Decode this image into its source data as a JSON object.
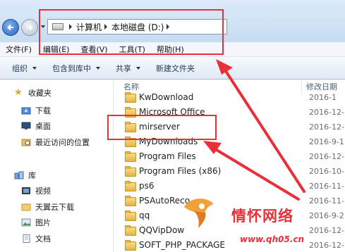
{
  "address": {
    "crumbs": [
      "计算机",
      "本地磁盘 (D:)"
    ]
  },
  "menu": [
    "文件(F)",
    "编辑(E)",
    "查看(V)",
    "工具(T)",
    "帮助(H)"
  ],
  "toolbar": {
    "organize": "组织",
    "include_library": "包含到库中",
    "share": "共享",
    "new_folder": "新建文件夹"
  },
  "sidebar": {
    "favorites": "收藏夹",
    "favorites_items": [
      "下载",
      "桌面",
      "最近访问的位置"
    ],
    "libraries": "库",
    "library_items": [
      "视频",
      "天翼云下载",
      "图片",
      "文档"
    ]
  },
  "columns": {
    "name": "名称",
    "date": "修改日期"
  },
  "files": [
    {
      "name": "KwDownload",
      "date": "2016-1"
    },
    {
      "name": "Microsoft Office",
      "date": "2016-12-"
    },
    {
      "name": "mirserver",
      "date": "2016-12-"
    },
    {
      "name": "MyDownloads",
      "date": "2016-9-1"
    },
    {
      "name": "Program Files",
      "date": "2016-12-"
    },
    {
      "name": "Program Files (x86)",
      "date": "2016-10-"
    },
    {
      "name": "ps6",
      "date": "2016-11-"
    },
    {
      "name": "PSAutoReco",
      "date": "2016-11-"
    },
    {
      "name": "qq",
      "date": "2016-9-2"
    },
    {
      "name": "QQVipDow",
      "date": "2016-12-"
    },
    {
      "name": "SOFT_PHP_PACKAGE",
      "date": "2016-12-"
    }
  ],
  "watermark": {
    "title": "情怀网络",
    "url": "www.qh05.cn"
  },
  "colors": {
    "highlight": "#e8303b",
    "toolbar_text": "#1e395b"
  },
  "icons": [
    "back-arrow-icon",
    "forward-arrow-icon",
    "drive-icon",
    "star-icon",
    "download-folder-icon",
    "desktop-icon",
    "recent-places-icon",
    "library-icon",
    "video-icon",
    "folder-icon",
    "picture-icon",
    "document-icon"
  ]
}
